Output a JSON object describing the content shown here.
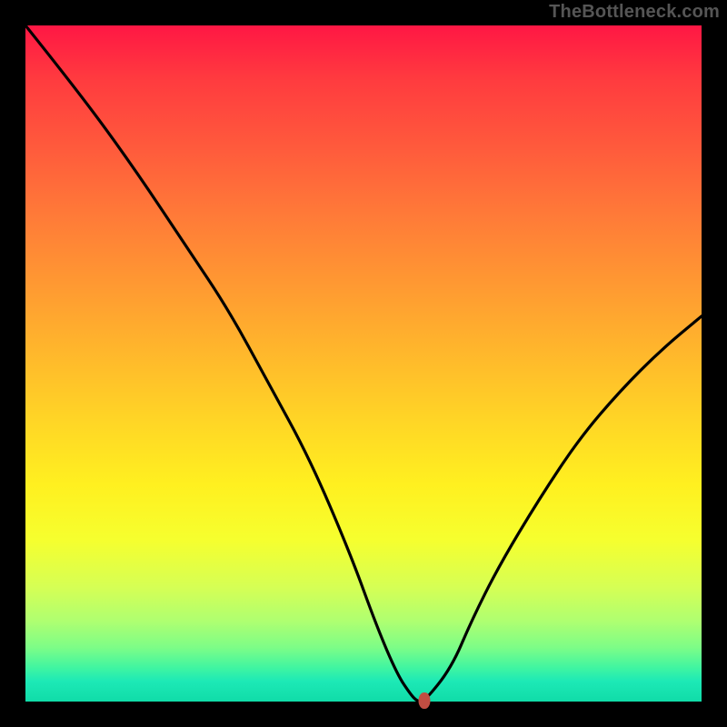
{
  "watermark": "TheBottleneck.com",
  "chart_data": {
    "type": "line",
    "title": "",
    "xlabel": "",
    "ylabel": "",
    "xlim": [
      0,
      100
    ],
    "ylim": [
      0,
      100
    ],
    "grid": false,
    "legend": false,
    "series": [
      {
        "name": "curve",
        "x": [
          0,
          8,
          16,
          24,
          30,
          36,
          42,
          48,
          52,
          55,
          57,
          58,
          59,
          63,
          66,
          70,
          76,
          82,
          88,
          94,
          100
        ],
        "values": [
          100,
          90,
          79,
          67,
          58,
          47,
          36,
          22,
          11,
          4,
          1,
          0,
          0,
          5,
          12,
          20,
          30,
          39,
          46,
          52,
          57
        ]
      }
    ],
    "marker": {
      "x": 59,
      "y": 0.2,
      "color": "#c14d42"
    },
    "background": "rainbow-vertical",
    "colors": {
      "curve": "#000000",
      "frame": "#000000"
    }
  }
}
